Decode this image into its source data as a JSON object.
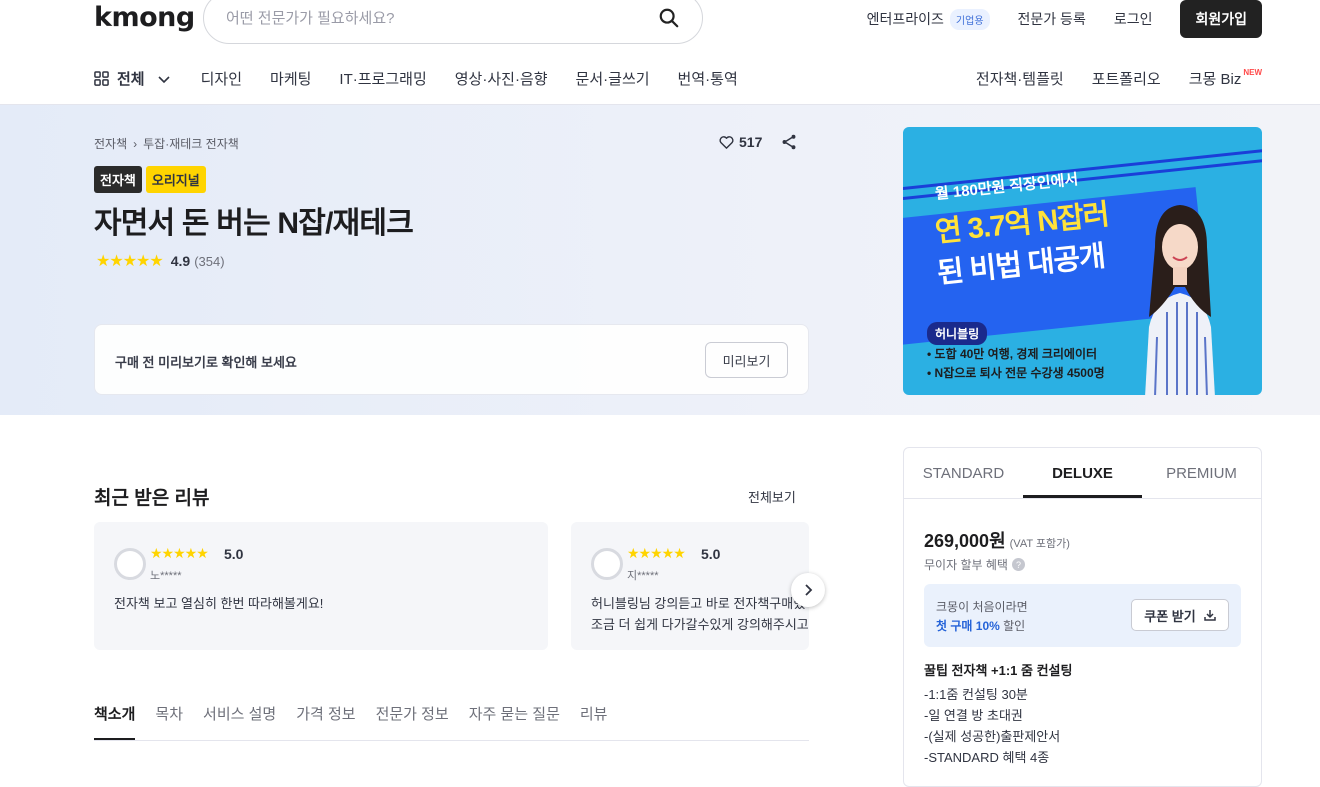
{
  "header": {
    "logo": "kmong",
    "search_placeholder": "어떤 전문가가 필요하세요?",
    "enterprise": "엔터프라이즈",
    "enterprise_badge": "기업용",
    "register_expert": "전문가 등록",
    "login": "로그인",
    "signup": "회원가입"
  },
  "nav": {
    "all": "전체",
    "items": [
      "디자인",
      "마케팅",
      "IT·프로그래밍",
      "영상·사진·음향",
      "문서·글쓰기",
      "번역·통역"
    ],
    "right_items": [
      "전자책·템플릿",
      "포트폴리오",
      "크몽 Biz"
    ],
    "new_tag": "NEW"
  },
  "hero": {
    "breadcrumb": [
      "전자책",
      "투잡·재테크 전자책"
    ],
    "likes": "517",
    "tag_ebook": "전자책",
    "tag_original": "오리지널",
    "title": "자면서 돈 버는 N잡/재테크",
    "stars": "★★★★★",
    "rating": "4.9",
    "rating_count": "(354)",
    "preview_text": "구매 전 미리보기로 확인해 보세요",
    "preview_button": "미리보기"
  },
  "banner": {
    "sub": "월 180만원 직장인에서",
    "head1": "연 3.7억 N잡러",
    "head2": "된 비법 대공개",
    "badge": "허니블링",
    "bullets": [
      "• 도합 40만 여행, 경제 크리에이터",
      "• N잡으로 퇴사 전문 수강생 4500명"
    ]
  },
  "reviews": {
    "title": "최근 받은 리뷰",
    "view_all": "전체보기",
    "items": [
      {
        "stars": "★★★★★",
        "score": "5.0",
        "user": "노*****",
        "text": "전자책 보고 열심히 한번 따라해볼게요!",
        "text2": ""
      },
      {
        "stars": "★★★★★",
        "score": "5.0",
        "user": "지*****",
        "text": "허니블링님 강의듣고 바로 전자책구매했",
        "text2": "조금 더 쉽게 다가갈수있게 강의해주시고"
      }
    ]
  },
  "tabs": [
    "책소개",
    "목차",
    "서비스 설명",
    "가격 정보",
    "전문가 정보",
    "자주 묻는 질문",
    "리뷰"
  ],
  "pricing": {
    "plans": [
      "STANDARD",
      "DELUXE",
      "PREMIUM"
    ],
    "price": "269,000원",
    "vat": "(VAT 포함가)",
    "installment": "무이자 할부 혜택",
    "coupon_line1": "크몽이 처음이라면",
    "coupon_highlight": "첫 구매 10%",
    "coupon_suffix": " 할인",
    "coupon_button": "쿠폰 받기",
    "package_title": "꿀팁 전자책 +1:1 줌 컨설팅",
    "package_items": [
      "-1:1줌 컨설팅 30분",
      "-일 연결 방 초대권",
      "-(실제 성공한)출판제안서",
      "-STANDARD 혜택 4종"
    ]
  }
}
